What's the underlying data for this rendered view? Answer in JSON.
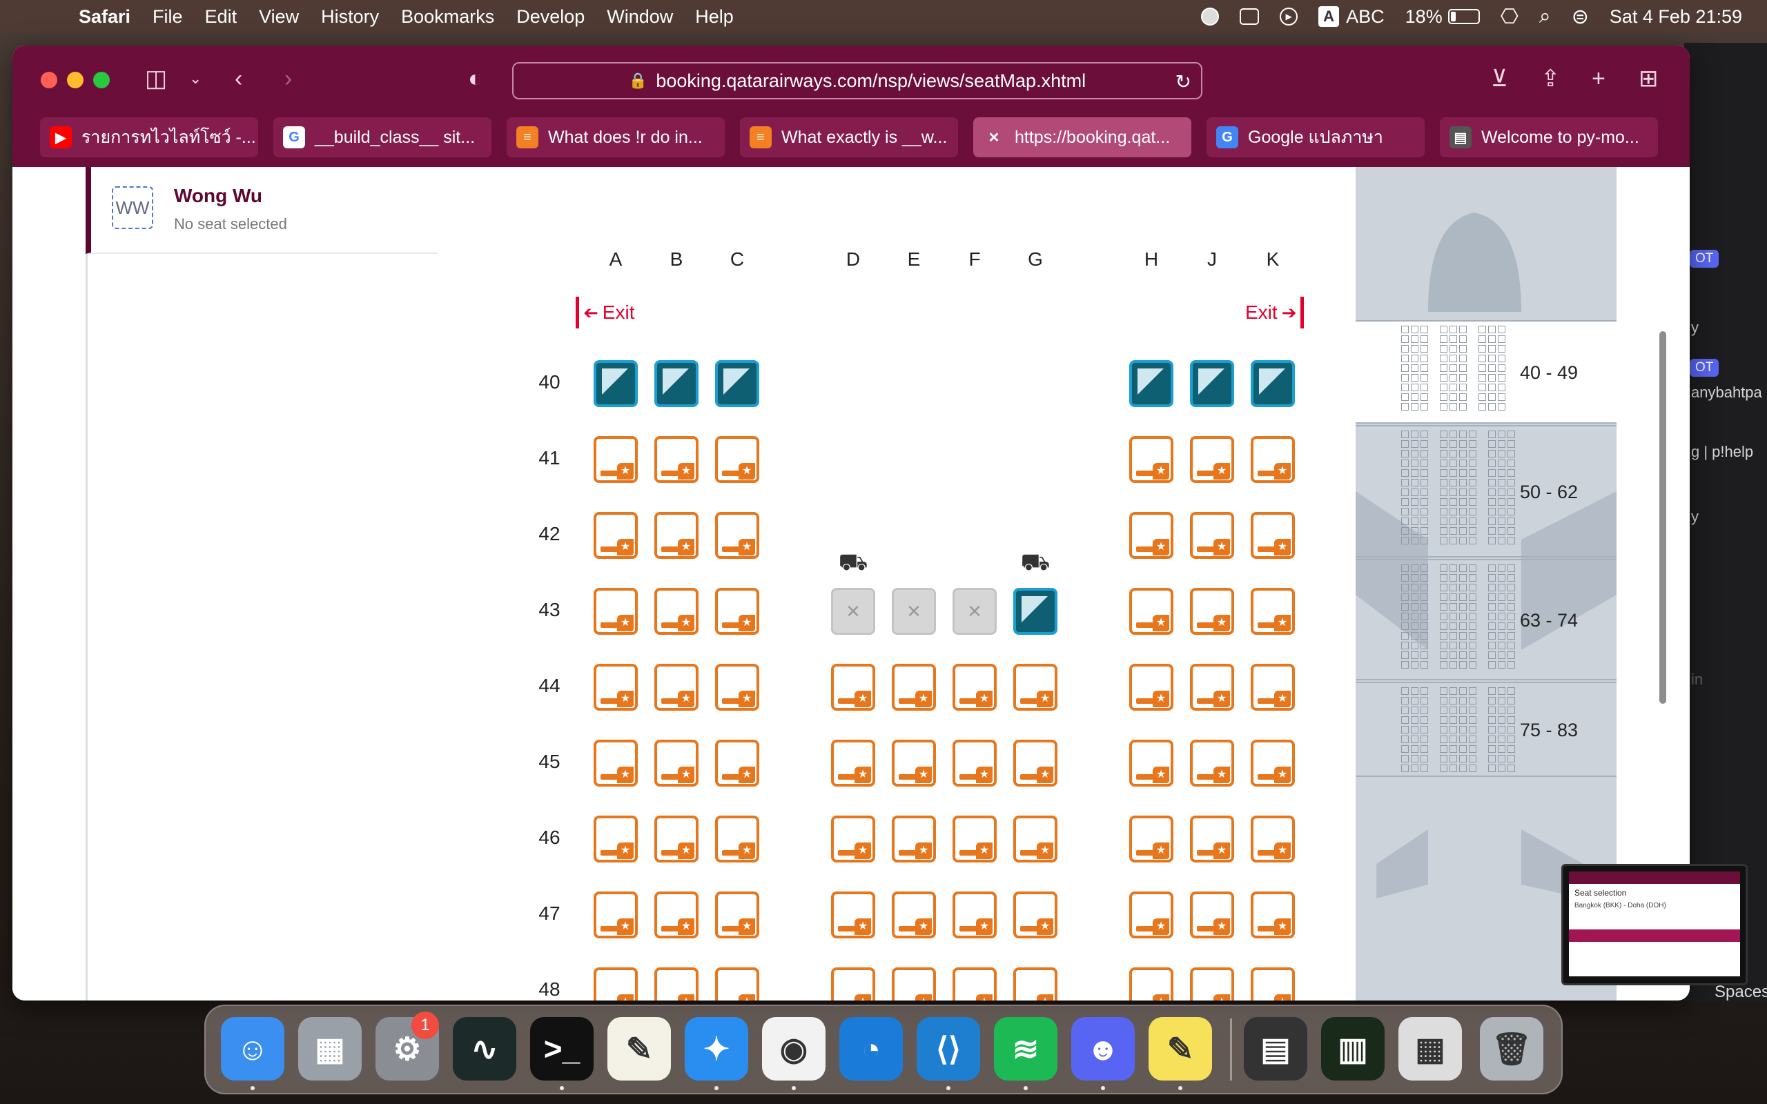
{
  "menubar": {
    "apple": "",
    "app": "Safari",
    "items": [
      "File",
      "Edit",
      "View",
      "History",
      "Bookmarks",
      "Develop",
      "Window",
      "Help"
    ],
    "input_source": "ABC",
    "battery": "18%",
    "battery_level": 0.18,
    "datetime": "Sat 4 Feb  21:59"
  },
  "browser": {
    "url": "booking.qatarairways.com/nsp/views/seatMap.xhtml",
    "tabs": [
      {
        "label": "รายการทไวไลท์โซว์ -...",
        "icon": "youtube-icon",
        "color": "#ff0000"
      },
      {
        "label": "__build_class__ sit...",
        "icon": "google-icon",
        "color": "#ffffff"
      },
      {
        "label": "What does !r do in...",
        "icon": "stackoverflow-icon",
        "color": "#f48024"
      },
      {
        "label": "What exactly is __w...",
        "icon": "stackoverflow-icon",
        "color": "#f48024"
      },
      {
        "label": "https://booking.qat...",
        "icon": "qatar-icon",
        "color": "#b24a78"
      },
      {
        "label": "Google แปลภาษา",
        "icon": "translate-icon",
        "color": "#4285f4"
      },
      {
        "label": "Welcome to py-mo...",
        "icon": "docs-icon",
        "color": "#555555"
      }
    ],
    "active_tab": 4
  },
  "passenger": {
    "initials": "WW",
    "name": "Wong Wu",
    "seat_status": "No seat selected"
  },
  "seatmap": {
    "exit_label": "Exit",
    "columns": [
      "A",
      "B",
      "C",
      "D",
      "E",
      "F",
      "G",
      "H",
      "J",
      "K"
    ],
    "rows": [
      "40",
      "41",
      "42",
      "43",
      "44",
      "45",
      "46",
      "47",
      "48"
    ],
    "row_types": {
      "40": {
        "A": "extra",
        "B": "extra",
        "C": "extra",
        "H": "extra",
        "J": "extra",
        "K": "extra"
      },
      "43": {
        "A": "avail",
        "B": "avail",
        "C": "avail",
        "D": "blocked",
        "E": "blocked",
        "F": "blocked",
        "G": "extra",
        "H": "avail",
        "J": "avail",
        "K": "avail"
      }
    },
    "bassinet_seats": [
      "43D",
      "43G"
    ],
    "blocked_mark": "✕",
    "colors": {
      "available": "#e8761c",
      "extra_legroom": "#0f5f72",
      "blocked": "#d6d6d6",
      "exit": "#e4002b"
    }
  },
  "overview": {
    "sections": [
      {
        "label": "40 - 49",
        "active": true
      },
      {
        "label": "50 - 62",
        "active": false
      },
      {
        "label": "63 - 74",
        "active": false
      },
      {
        "label": "75 - 83",
        "active": false
      }
    ]
  },
  "background_window": {
    "snippets": [
      "OT",
      "y",
      "OT",
      "anybahtpa",
      "g | p!help",
      "y",
      "in"
    ]
  },
  "thumbnail": {
    "title": "Seat selection",
    "subtitle": "Bangkok (BKK) - Doha (DOH)"
  },
  "dock": {
    "apps": [
      "Finder",
      "Launchpad",
      "System Settings",
      "Activity Monitor",
      "Terminal",
      "TextEdit",
      "Safari",
      "Chrome",
      "Edge",
      "VS Code",
      "Spotify",
      "Discord",
      "Python Launcher",
      "Window 1",
      "Window 2",
      "Window 3",
      "Trash"
    ],
    "settings_badge": "1"
  },
  "spaces_label": "Spaces"
}
